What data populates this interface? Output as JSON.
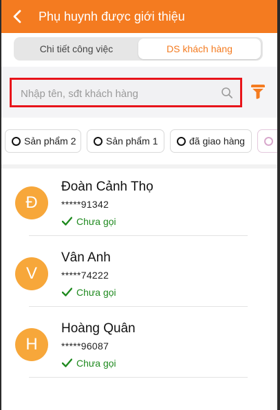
{
  "header": {
    "title": "Phụ huynh được giới thiệu",
    "background": "#f47b20"
  },
  "tabs": [
    {
      "label": "Chi tiết công việc",
      "active": false
    },
    {
      "label": "DS khách hàng",
      "active": true
    }
  ],
  "search": {
    "value": "",
    "placeholder": "Nhập tên, sđt khách hàng",
    "highlight_color": "#e8141a"
  },
  "filter_chips": [
    {
      "label": "Sản phẩm 2",
      "selected": false
    },
    {
      "label": "Sản phẩm 1",
      "selected": false
    },
    {
      "label": "đã giao hàng",
      "selected": false
    },
    {
      "label": "",
      "selected": false
    }
  ],
  "customers": [
    {
      "initial": "Đ",
      "name": "Đoàn Cảnh Thọ",
      "phone": "*****91342",
      "status": "Chưa gọi"
    },
    {
      "initial": "V",
      "name": "Vân Anh",
      "phone": "*****74222",
      "status": "Chưa gọi"
    },
    {
      "initial": "H",
      "name": "Hoàng Quân",
      "phone": "*****96087",
      "status": "Chưa gọi"
    }
  ],
  "icons": {
    "back": "chevron-left-icon",
    "search": "search-icon",
    "filter": "filter-funnel-icon",
    "status": "check-icon"
  },
  "colors": {
    "accent": "#f47b20",
    "avatar": "#f7a73a",
    "status_green": "#1f8a1f"
  }
}
